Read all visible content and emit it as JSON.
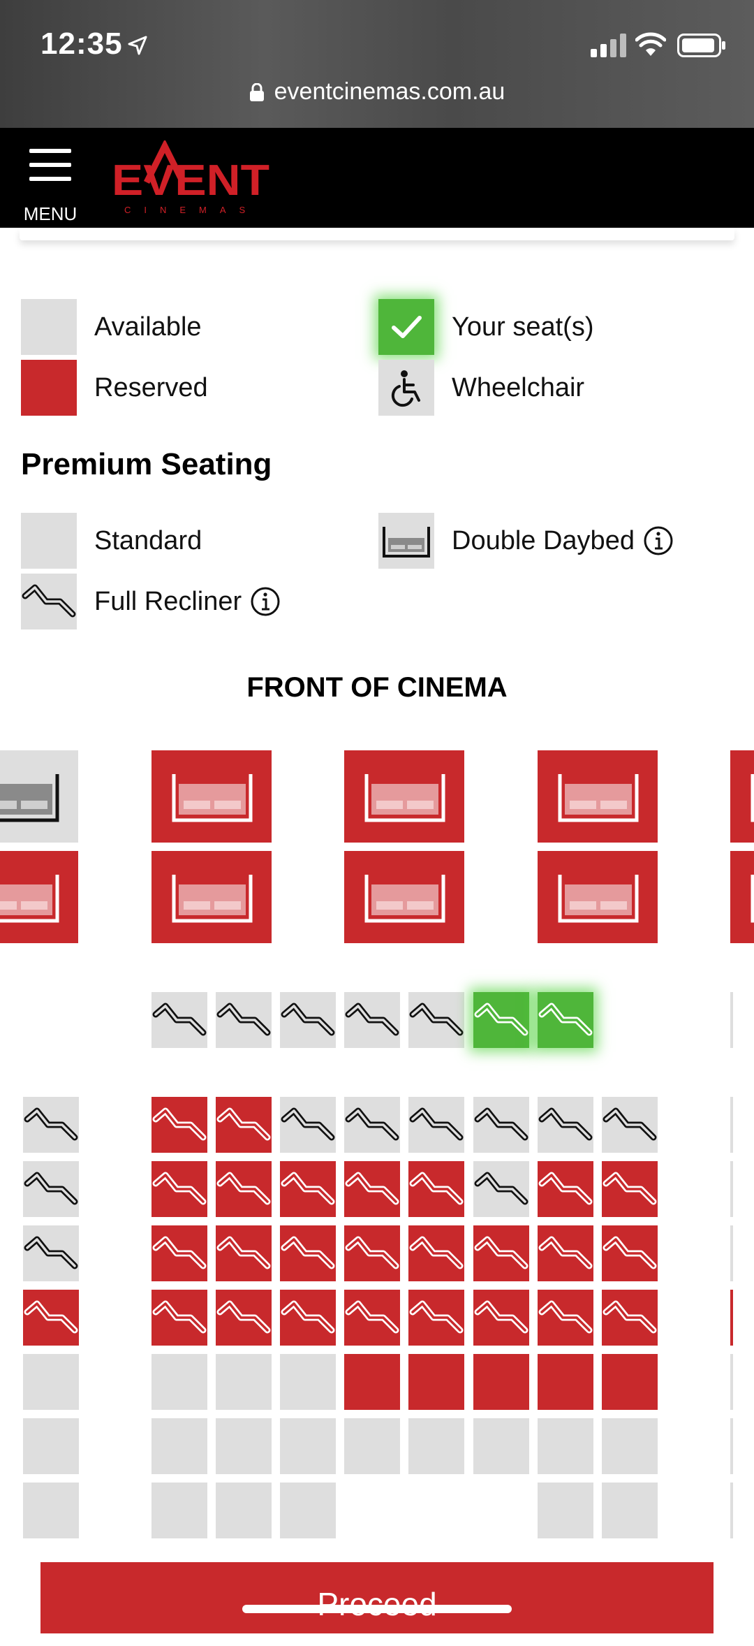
{
  "status_bar": {
    "time": "12:35",
    "icons": [
      "location-arrow-icon",
      "signal-icon",
      "wifi-icon",
      "battery-icon"
    ]
  },
  "browser": {
    "url": "eventcinemas.com.au",
    "lock_icon": "lock-icon"
  },
  "header": {
    "menu_label": "MENU",
    "logo_text": "EVENT",
    "logo_subtext": "CINEMAS"
  },
  "legend": {
    "available": "Available",
    "your_seats": "Your seat(s)",
    "reserved": "Reserved",
    "wheelchair": "Wheelchair"
  },
  "premium": {
    "title": "Premium Seating",
    "standard": "Standard",
    "double_daybed": "Double Daybed",
    "full_recliner": "Full Recliner"
  },
  "front_label": "FRONT OF CINEMA",
  "seat_map": {
    "daybed_rows": [
      [
        "grey",
        "red",
        "red",
        "red",
        "red"
      ],
      [
        "red",
        "red",
        "red",
        "red",
        "red"
      ]
    ],
    "recliner_front_row": [
      "grey",
      "grey",
      "grey",
      "grey",
      "grey",
      "green",
      "green"
    ],
    "recliner_rows": [
      [
        "grey",
        "red",
        "red",
        "grey",
        "grey",
        "grey",
        "grey",
        "grey",
        "grey"
      ],
      [
        "grey",
        "red",
        "red",
        "red",
        "red",
        "red",
        "grey",
        "red",
        "red"
      ],
      [
        "grey",
        "red",
        "red",
        "red",
        "red",
        "red",
        "red",
        "red",
        "red"
      ],
      [
        "red",
        "red",
        "red",
        "red",
        "red",
        "red",
        "red",
        "red",
        "red"
      ]
    ],
    "standard_rows": [
      [
        "grey",
        "grey",
        "grey",
        "grey",
        "red",
        "red",
        "red",
        "red",
        "red"
      ],
      [
        "grey",
        "grey",
        "grey",
        "grey",
        "grey",
        "grey",
        "grey",
        "grey",
        "grey"
      ],
      [
        "grey",
        "grey",
        "grey",
        "grey",
        null,
        null,
        null,
        "grey",
        "grey"
      ]
    ]
  },
  "proceed_label": "Proceed",
  "colors": {
    "reserved": "#c8292c",
    "available": "#dedede",
    "selected": "#4fb63a",
    "header_bg": "#000000"
  }
}
